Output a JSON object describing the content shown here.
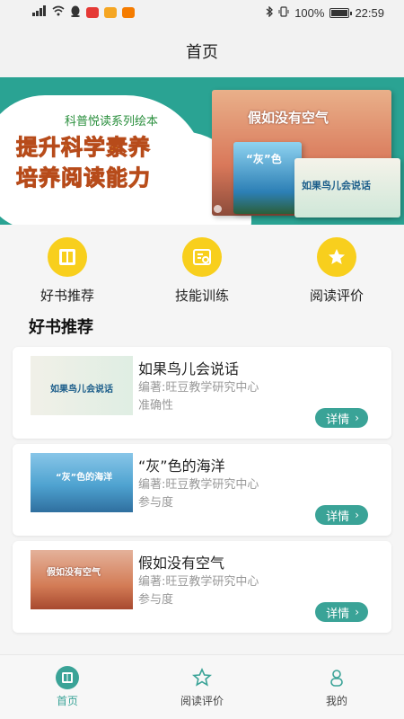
{
  "status_bar": {
    "battery": "100%",
    "time": "22:59"
  },
  "header": {
    "title": "首页"
  },
  "banner": {
    "subtitle": "科普悦读系列绘本",
    "line1": "提升科学素养",
    "line2": "培养阅读能力",
    "book_a_title": "假如没有空气",
    "book_b_title": "“灰”色",
    "book_c_title": "如果鸟儿会说话",
    "slides": 3,
    "active_slide": 1
  },
  "quick_nav": [
    {
      "label": "好书推荐",
      "icon": "book-icon"
    },
    {
      "label": "技能训练",
      "icon": "training-icon"
    },
    {
      "label": "阅读评价",
      "icon": "star-icon"
    }
  ],
  "section": {
    "title": "好书推荐"
  },
  "books": [
    {
      "title": "如果鸟儿会说话",
      "author": "编著:旺豆教学研究中心",
      "tag": "准确性",
      "button": "详情",
      "thumb_text": "如果鸟儿会说话"
    },
    {
      "title": "“灰”色的海洋",
      "author": "编著:旺豆教学研究中心",
      "tag": "参与度",
      "button": "详情",
      "thumb_text": "“灰”色的海洋"
    },
    {
      "title": "假如没有空气",
      "author": "编著:旺豆教学研究中心",
      "tag": "参与度",
      "button": "详情",
      "thumb_text": "假如没有空气"
    }
  ],
  "tab_bar": [
    {
      "label": "首页",
      "icon": "book-icon",
      "active": true
    },
    {
      "label": "阅读评价",
      "icon": "star-icon"
    },
    {
      "label": "我的",
      "icon": "person-icon"
    }
  ],
  "colors": {
    "accent": "#3aa397",
    "yellow": "#f8cf1d",
    "banner": "#2aa393"
  }
}
